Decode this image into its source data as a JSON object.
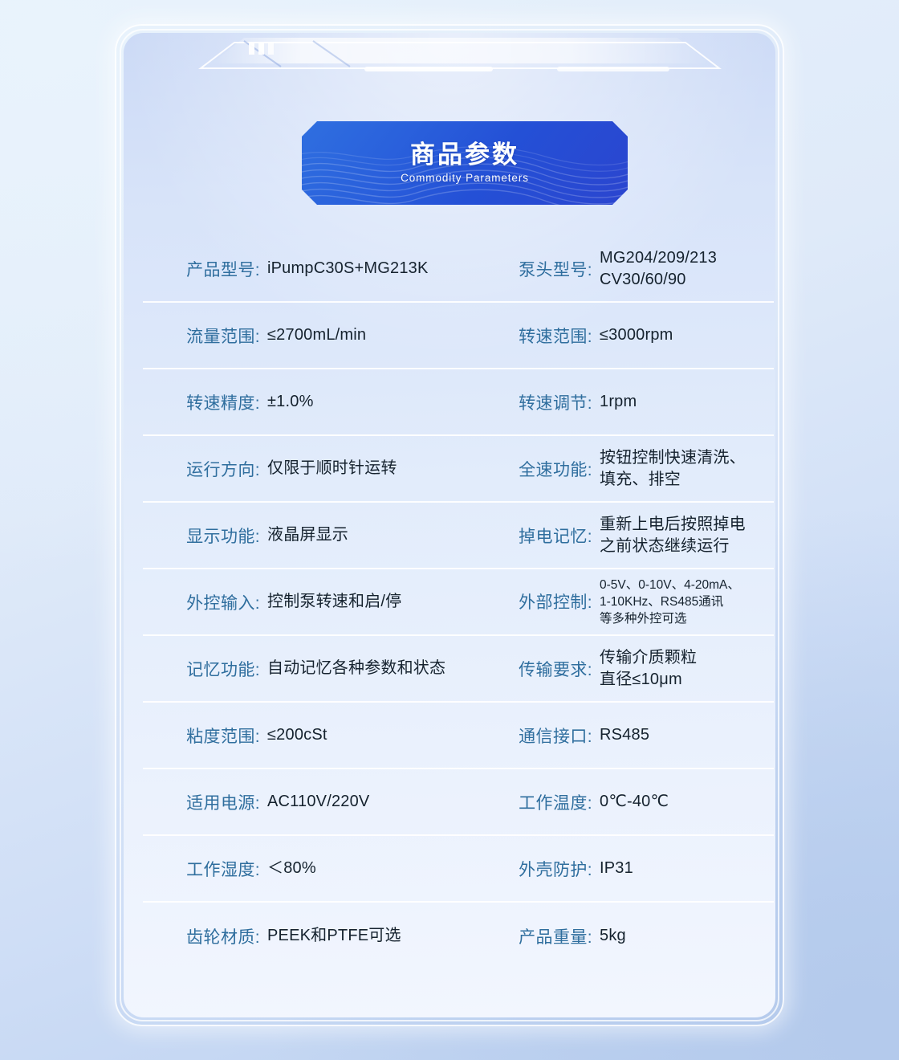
{
  "banner": {
    "title": "商品参数",
    "subtitle": "Commodity Parameters"
  },
  "colors": {
    "label": "#2f6e9e",
    "value": "#15222e",
    "banner_start": "#2f6fe0",
    "banner_end": "#2b45cf",
    "page_bg_top": "#e6f1fb",
    "page_bg_bottom": "#b9cfef",
    "divider": "#ffffff"
  },
  "spec_rows": [
    {
      "left": {
        "label": "产品型号",
        "value": [
          "iPumpC30S+MG213K"
        ]
      },
      "right": {
        "label": "泵头型号",
        "value": [
          "MG204/209/213",
          "CV30/60/90"
        ]
      }
    },
    {
      "left": {
        "label": "流量范围",
        "value": [
          "≤2700mL/min"
        ]
      },
      "right": {
        "label": "转速范围",
        "value": [
          "≤3000rpm"
        ]
      }
    },
    {
      "left": {
        "label": "转速精度",
        "value": [
          "±1.0%"
        ]
      },
      "right": {
        "label": "转速调节",
        "value": [
          "1rpm"
        ]
      }
    },
    {
      "left": {
        "label": "运行方向",
        "value": [
          "仅限于顺时针运转"
        ]
      },
      "right": {
        "label": "全速功能",
        "value": [
          "按钮控制快速清洗、",
          "填充、排空"
        ]
      }
    },
    {
      "left": {
        "label": "显示功能",
        "value": [
          "液晶屏显示"
        ]
      },
      "right": {
        "label": "掉电记忆",
        "value": [
          "重新上电后按照掉电",
          "之前状态继续运行"
        ]
      }
    },
    {
      "left": {
        "label": "外控输入",
        "value": [
          "控制泵转速和启/停"
        ]
      },
      "right": {
        "label": "外部控制",
        "value": [
          "0-5V、0-10V、4-20mA、",
          "1-10KHz、RS485通讯",
          "等多种外控可选"
        ],
        "small": true
      }
    },
    {
      "left": {
        "label": "记忆功能",
        "value": [
          "自动记忆各种参数和状态"
        ]
      },
      "right": {
        "label": "传输要求",
        "value": [
          "传输介质颗粒",
          "直径≤10μm"
        ]
      }
    },
    {
      "left": {
        "label": "粘度范围",
        "value": [
          "≤200cSt"
        ]
      },
      "right": {
        "label": "通信接口",
        "value": [
          "RS485"
        ]
      }
    },
    {
      "left": {
        "label": "适用电源",
        "value": [
          "AC110V/220V"
        ]
      },
      "right": {
        "label": "工作温度",
        "value": [
          "0℃-40℃"
        ]
      }
    },
    {
      "left": {
        "label": "工作湿度",
        "value": [
          "＜80%"
        ]
      },
      "right": {
        "label": "外壳防护",
        "value": [
          "IP31"
        ]
      }
    },
    {
      "left": {
        "label": "齿轮材质",
        "value": [
          "PEEK和PTFE可选"
        ]
      },
      "right": {
        "label": "产品重量",
        "value": [
          "5kg"
        ]
      }
    }
  ]
}
